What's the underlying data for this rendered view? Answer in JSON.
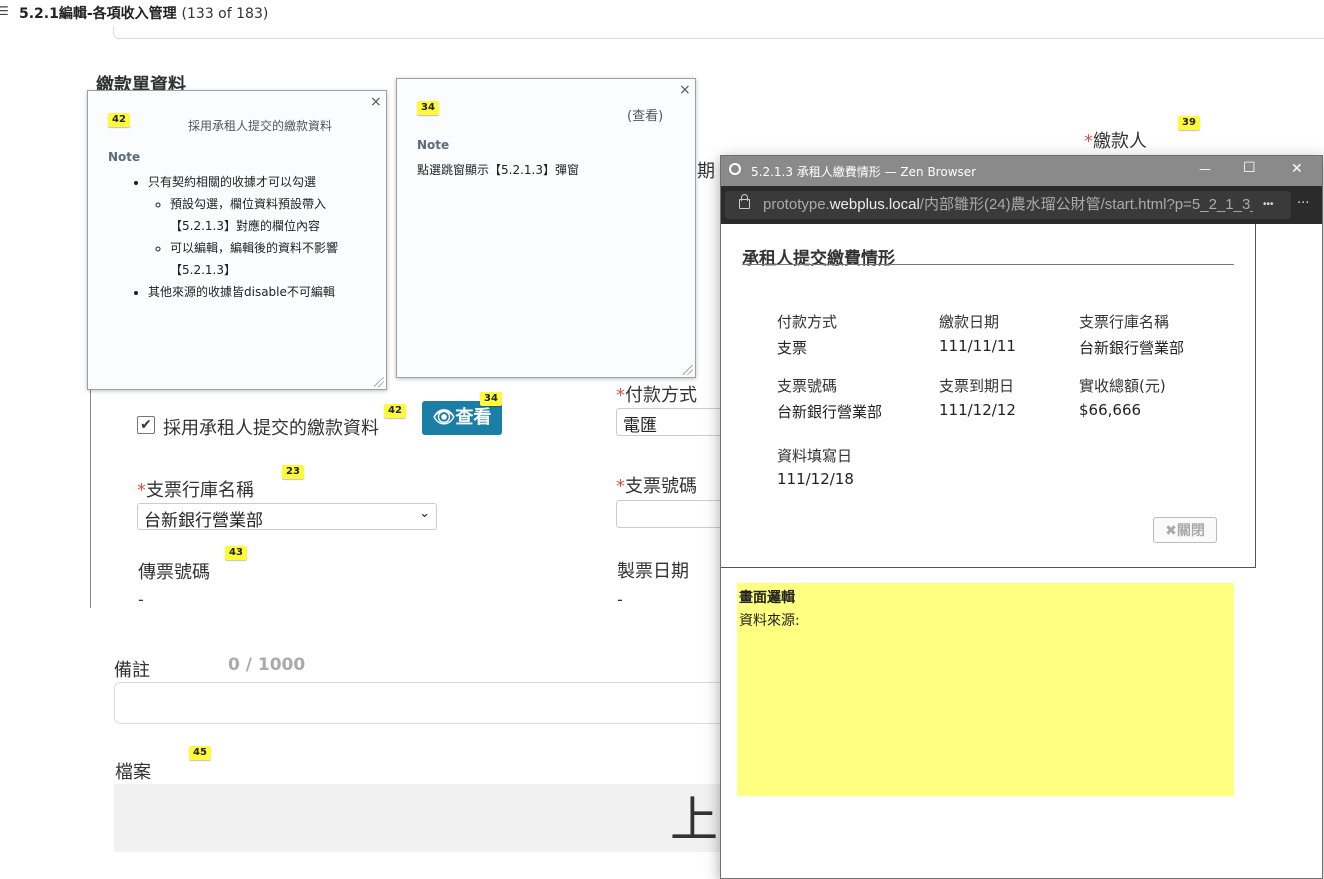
{
  "page_header": {
    "menu_icon": "list-icon",
    "title": "5.2.1編輯-各項收入管理",
    "counter": "(133 of 183)"
  },
  "section_title": "繳款單資料",
  "badges": {
    "b42": "42",
    "b34": "34",
    "b39": "39",
    "b23": "23",
    "b43": "43",
    "b45": "45"
  },
  "form": {
    "payer_label": "繳款人",
    "use_tenant_checkbox_label": "採用承租人提交的繳款資料",
    "view_button_label": "查看",
    "payment_method_label": "付款方式",
    "payment_method_value": "電匯",
    "bank_name_label": "支票行庫名稱",
    "bank_name_value": "台新銀行營業部",
    "check_no_label": "支票號碼",
    "voucher_no_label": "傳票號碼",
    "voucher_no_value": "-",
    "voucher_date_label": "製票日期",
    "voucher_date_value": "-",
    "remarks_label": "備註",
    "remarks_counter": "0 / 1000",
    "files_label": "檔案",
    "upload_text": "上",
    "partial_label": "期",
    "required_mark": "*"
  },
  "note42": {
    "badge": "42",
    "heading": "採用承租人提交的繳款資料",
    "note_title": "Note",
    "item1": "只有契約相關的收據才可以勾選",
    "sub1": "預設勾選，欄位資料預設帶入【5.2.1.3】對應的欄位內容",
    "sub2": "可以編輯，編輯後的資料不影響【5.2.1.3】",
    "item2": "其他來源的收據皆disable不可編輯",
    "close": "×"
  },
  "note34": {
    "badge": "34",
    "heading": "(查看)",
    "note_title": "Note",
    "text": "點選跳窗顯示【5.2.1.3】彈窗",
    "close": "×"
  },
  "browser": {
    "title": "5.2.1.3 承租人繳費情形 — Zen Browser",
    "url_host_prefix": "prototype.",
    "url_host_main": "webplus.local",
    "url_path": "/内部雛形(24)農水瑠公財管/start.html?p=5_2_1_3_",
    "url_more": "•••",
    "menu_more": "···",
    "minimize": "—",
    "maximize": "☐",
    "close": "✕",
    "dialog_title": "承租人提交繳費情形",
    "fields": [
      {
        "label": "付款方式",
        "value": "支票"
      },
      {
        "label": "繳款日期",
        "value": "111/11/11"
      },
      {
        "label": "支票行庫名稱",
        "value": "台新銀行營業部"
      },
      {
        "label": "支票號碼",
        "value": "台新銀行營業部"
      },
      {
        "label": "支票到期日",
        "value": "111/12/12"
      },
      {
        "label": "實收總額(元)",
        "value": "$66,666"
      },
      {
        "label": "資料填寫日",
        "value": "111/12/18"
      }
    ],
    "close_button": "關閉",
    "logic_title": "畫面邏輯",
    "logic_source": "資料來源:"
  },
  "colors": {
    "badge": "#fffb3a",
    "view_button": "#1a7ea6",
    "logic_panel": "#ffff80",
    "required": "#d9534f"
  }
}
